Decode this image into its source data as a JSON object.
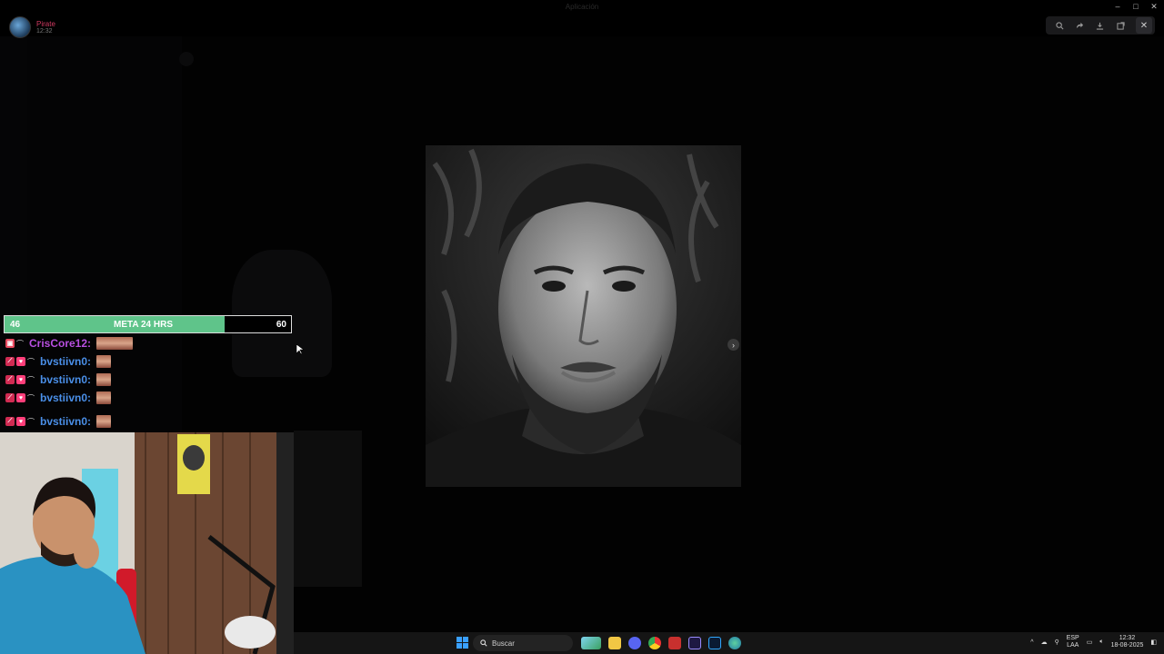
{
  "window": {
    "title": "Aplicación"
  },
  "user": {
    "name": "Pirate",
    "time": "12:32"
  },
  "viewer": {
    "toolbar_icons": [
      "zoom-in-icon",
      "forward-icon",
      "download-icon",
      "open-external-icon",
      "more-icon"
    ],
    "close_label": "✕",
    "next_label": "›"
  },
  "goal": {
    "current": "46",
    "label": "META 24 HRS",
    "target": "60",
    "progress": 0.7667
  },
  "chat": [
    {
      "user": "CrisCore12:",
      "color": "#b84fe0",
      "badges": [
        "box"
      ],
      "emote": "wide"
    },
    {
      "user": "bvstiivn0:",
      "color": "#4a8fe8",
      "badges": [
        "sword",
        "heart"
      ],
      "emote": "square"
    },
    {
      "user": "bvstiivn0:",
      "color": "#4a8fe8",
      "badges": [
        "sword",
        "heart"
      ],
      "emote": "square"
    },
    {
      "user": "bvstiivn0:",
      "color": "#4a8fe8",
      "badges": [
        "sword",
        "heart"
      ],
      "emote": "square"
    },
    {
      "user": "bvstiivn0:",
      "color": "#4a8fe8",
      "badges": [
        "sword",
        "heart"
      ],
      "emote": "square"
    }
  ],
  "taskbar": {
    "search_label": "Buscar",
    "lang_primary": "ESP",
    "lang_secondary": "LAA",
    "clock_time": "12:32",
    "clock_date": "18-08-2025"
  },
  "colors": {
    "goal_fill": "#5fc48a",
    "accent_discord": "#5865f2"
  }
}
